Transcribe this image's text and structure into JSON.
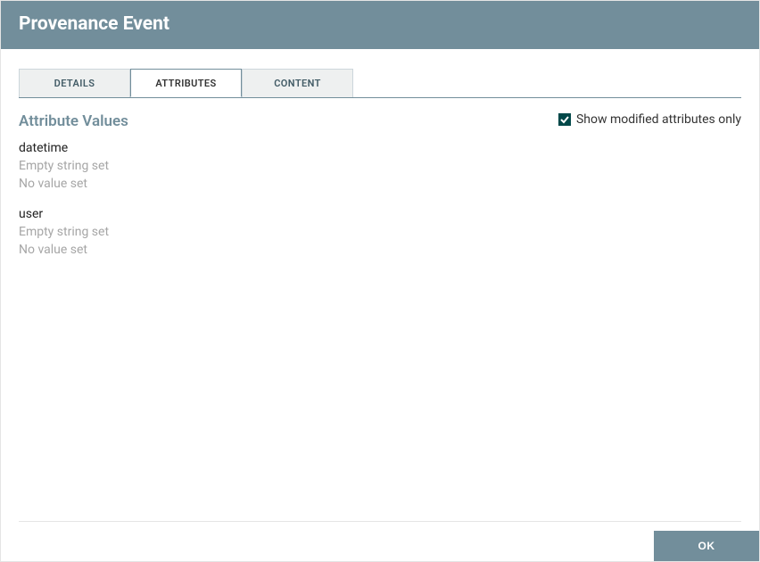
{
  "title": "Provenance Event",
  "tabs": {
    "details": "DETAILS",
    "attributes": "ATTRIBUTES",
    "content": "CONTENT",
    "active": "attributes"
  },
  "section": {
    "heading": "Attribute Values",
    "show_modified_label": "Show modified attributes only",
    "show_modified_checked": true
  },
  "attributes": [
    {
      "name": "datetime",
      "line1": "Empty string set",
      "line2": "No value set"
    },
    {
      "name": "user",
      "line1": "Empty string set",
      "line2": "No value set"
    }
  ],
  "buttons": {
    "ok": "OK"
  }
}
